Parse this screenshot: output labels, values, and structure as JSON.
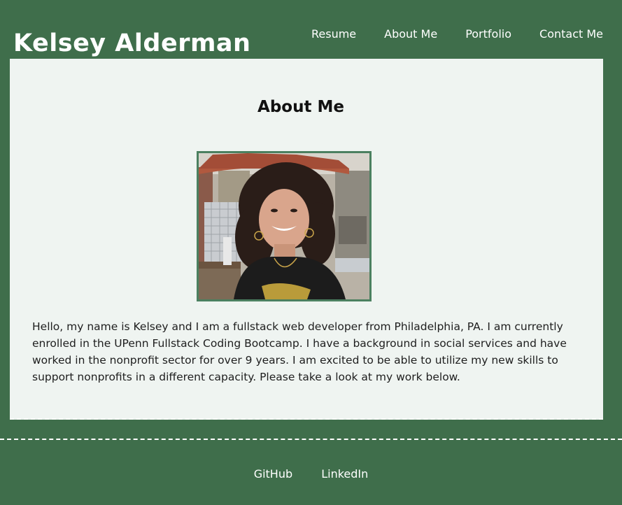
{
  "header": {
    "title": "Kelsey Alderman",
    "nav": [
      {
        "label": "Resume"
      },
      {
        "label": "About Me"
      },
      {
        "label": "Portfolio"
      },
      {
        "label": "Contact Me"
      }
    ]
  },
  "main": {
    "heading": "About Me",
    "bio": "Hello, my name is Kelsey and I am a fullstack web developer from Philadelphia, PA. I am currently enrolled in the UPenn Fullstack Coding Bootcamp. I have a background in social services and have worked in the nonprofit sector for over 9 years. I am excited to be able to utilize my new skills to support nonprofits in a different capacity. Please take a look at my work below."
  },
  "footer": {
    "links": [
      {
        "label": "GitHub"
      },
      {
        "label": "LinkedIn"
      }
    ]
  },
  "colors": {
    "background": "#3f6e4b",
    "content_bg": "#eff4f1",
    "photo_border": "#4b8060"
  }
}
